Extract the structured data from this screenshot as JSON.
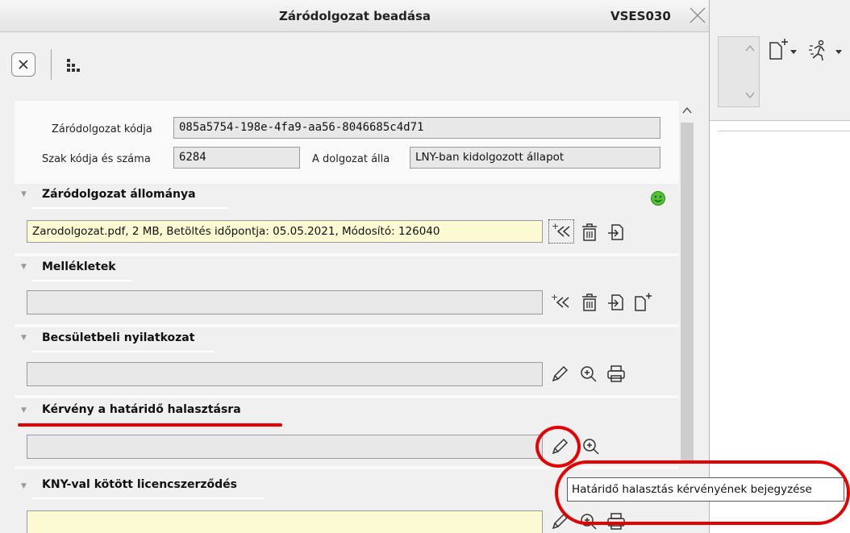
{
  "window": {
    "title": "Záródolgozat beadása",
    "code": "VSES030"
  },
  "toolbar": {
    "close_icon": "close-icon",
    "tree_icon": "hierarchy-icon"
  },
  "form": {
    "thesis_code_label": "Záródolgozat kódja",
    "thesis_code_value": "085a5754-198e-4fa9-aa56-8046685c4d71",
    "major_code_label": "Szak kódja és száma",
    "major_code_value": "6284",
    "status_label": "A dolgozat álla",
    "status_value": "LNY-ban kidolgozott állapot"
  },
  "sections": {
    "thesis_file": {
      "title": "Záródolgozat állománya",
      "value": "Zarodolgozat.pdf, 2 MB, Betöltés időpontja: 05.05.2021, Módosító: 126040",
      "status_icon": "smiley-icon"
    },
    "attachments": {
      "title": "Mellékletek",
      "value": ""
    },
    "declaration": {
      "title": "Becsületbeli nyilatkozat",
      "value": ""
    },
    "deadline_request": {
      "title": "Kérvény a határidő halasztásra",
      "value": ""
    },
    "license": {
      "title": "KNY-val kötött licencszerződés",
      "value": ""
    }
  },
  "tooltip": {
    "text": "Határidő halasztás kérvényének bejegyzése"
  },
  "annotation_color": "#e60000"
}
